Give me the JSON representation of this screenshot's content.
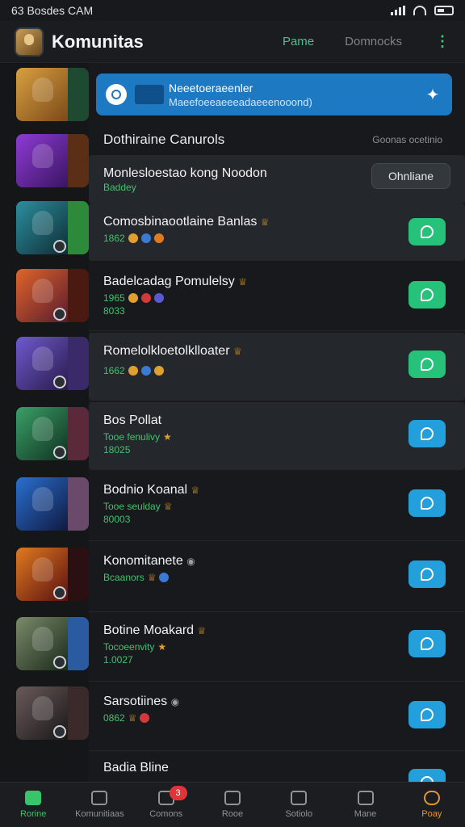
{
  "status_bar": {
    "left_text": "63 Bosdes CAM"
  },
  "header": {
    "title": "Komunitas",
    "tab_game": "Pame",
    "tab_other": "Domnocks",
    "menu_icon": "more-vertical-icon"
  },
  "banner": {
    "title": "Neeetoeraeenler",
    "subtitle": "Maeefoeeaeeeadaeeenooond)",
    "icon": "shield-icon",
    "action_icon": "star-pin-icon"
  },
  "section": {
    "title": "Dothiraine Canurols",
    "link": "Goonas ocetinio"
  },
  "rows": [
    {
      "name": "Monlesloestao kong Noodon",
      "sub": "Baddey",
      "sub2": "",
      "button": "Ohnliane",
      "button_type": "pill"
    },
    {
      "name": "Comosbinaootlaine Banlas",
      "sub": "1862",
      "sub2": "",
      "button_type": "green"
    },
    {
      "name": "Badelcadag Pomulelsy",
      "sub": "1965",
      "sub2": "8033",
      "button_type": "green"
    },
    {
      "name": "Romelolkloetolklloater",
      "sub": "1662",
      "sub2": "",
      "button_type": "green"
    },
    {
      "name": "Bos Pollat",
      "sub": "Tooe fenulivy",
      "sub2": "18025",
      "button_type": "blue"
    },
    {
      "name": "Bodnio Koanal",
      "sub": "Tooe seulday",
      "sub2": "80003",
      "button_type": "blue"
    },
    {
      "name": "Konomitanete",
      "sub": "Bcaanors",
      "sub2": "",
      "button_type": "blue"
    },
    {
      "name": "Botine Moakard",
      "sub": "Tocoeenvity",
      "sub2": "1.0027",
      "button_type": "blue"
    },
    {
      "name": "Sarsotiines",
      "sub": "0862",
      "sub2": "",
      "button_type": "blue"
    },
    {
      "name": "Badia Bline",
      "sub": "",
      "sub2": "",
      "button_type": "blue"
    }
  ],
  "bottom_nav": [
    {
      "label": "Rorine",
      "icon": "home-icon"
    },
    {
      "label": "Komunitiaas",
      "icon": "people-icon"
    },
    {
      "label": "Comons",
      "icon": "arrow-icon",
      "badge": "3"
    },
    {
      "label": "Rooe",
      "icon": "box-icon"
    },
    {
      "label": "Sotiolo",
      "icon": "heart-icon"
    },
    {
      "label": "Mane",
      "icon": "image-icon"
    },
    {
      "label": "Poay",
      "icon": "search-icon"
    }
  ]
}
